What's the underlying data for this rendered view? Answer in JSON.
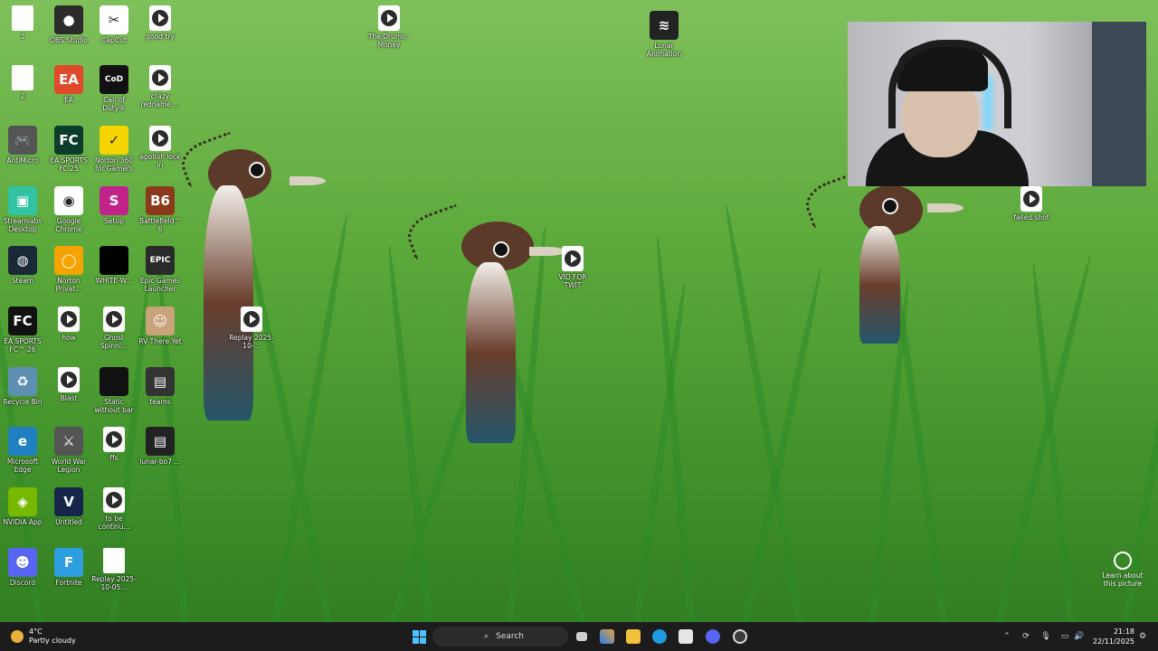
{
  "desktop": {
    "icons": [
      {
        "label": "1",
        "type": "doc"
      },
      {
        "label": "OBS Studio",
        "type": "app",
        "color": "#2b2b2b",
        "glyph": "●"
      },
      {
        "label": "CapCut",
        "type": "app",
        "color": "#ffffff",
        "glyph": "✂"
      },
      {
        "label": "good try",
        "type": "vid"
      },
      {
        "label": "The Drums - Money",
        "type": "vid"
      },
      {
        "label": "Lunar Animation",
        "type": "app",
        "color": "#222222",
        "glyph": "≋"
      },
      {
        "label": "2",
        "type": "doc"
      },
      {
        "label": "EA",
        "type": "app",
        "color": "#e04a2a",
        "glyph": "EA"
      },
      {
        "label": "Call of Duty®",
        "type": "app",
        "color": "#111111",
        "glyph": "CoD"
      },
      {
        "label": "crazy redname ...",
        "type": "vid"
      },
      {
        "label": "AntiMicro",
        "type": "app",
        "color": "#555555",
        "glyph": "🎮"
      },
      {
        "label": "EA SPORTS FC 25",
        "type": "app",
        "color": "#0c3d2a",
        "glyph": "FC"
      },
      {
        "label": "Norton 360 for Gamers",
        "type": "app",
        "color": "#f5d400",
        "glyph": "✓"
      },
      {
        "label": "apolloh lock in",
        "type": "vid"
      },
      {
        "label": "Streamlabs Desktop",
        "type": "app",
        "color": "#31c3a2",
        "glyph": "▣"
      },
      {
        "label": "Google Chrome",
        "type": "app",
        "color": "#ffffff",
        "glyph": "◉"
      },
      {
        "label": "Setup",
        "type": "app",
        "color": "#c1238a",
        "glyph": "S"
      },
      {
        "label": "Battlefield™ 6",
        "type": "app",
        "color": "#8a3a1a",
        "glyph": "B6"
      },
      {
        "label": "Steam",
        "type": "app",
        "color": "#1b2838",
        "glyph": "◍"
      },
      {
        "label": "Norton Privat...",
        "type": "app",
        "color": "#f5a300",
        "glyph": "◯"
      },
      {
        "label": "WHITE-W...",
        "type": "app",
        "color": "#000000",
        "glyph": ""
      },
      {
        "label": "Epic Games Launcher",
        "type": "app",
        "color": "#2a2a2a",
        "glyph": "EPIC"
      },
      {
        "label": "VID FOR TWIT",
        "type": "vid"
      },
      {
        "label": "EA SPORTS FC™ 26",
        "type": "app",
        "color": "#111111",
        "glyph": "FC"
      },
      {
        "label": "how",
        "type": "vid"
      },
      {
        "label": "Ghost Spinni...",
        "type": "vid"
      },
      {
        "label": "RV There Yet",
        "type": "app",
        "color": "#c9a37a",
        "glyph": "☺"
      },
      {
        "label": "Replay 2025-10-...",
        "type": "vid"
      },
      {
        "label": "Recycle Bin",
        "type": "app",
        "color": "#5d8fb0",
        "glyph": "♻"
      },
      {
        "label": "Blast",
        "type": "vid"
      },
      {
        "label": "Static without bar",
        "type": "app",
        "color": "#111111",
        "glyph": ""
      },
      {
        "label": "teams",
        "type": "app",
        "color": "#333333",
        "glyph": "▤"
      },
      {
        "label": "Microsoft Edge",
        "type": "app",
        "color": "#1f7fc1",
        "glyph": "e"
      },
      {
        "label": "World War Legion",
        "type": "app",
        "color": "#555555",
        "glyph": "⚔"
      },
      {
        "label": "ffs",
        "type": "vid"
      },
      {
        "label": "lunar-bo7 ...",
        "type": "app",
        "color": "#222222",
        "glyph": "▤"
      },
      {
        "label": "NVIDIA App",
        "type": "app",
        "color": "#76b900",
        "glyph": "◈"
      },
      {
        "label": "Untitled",
        "type": "app",
        "color": "#16264a",
        "glyph": "V"
      },
      {
        "label": "to be continu...",
        "type": "vid"
      },
      {
        "label": "Discord",
        "type": "app",
        "color": "#5865f2",
        "glyph": "☻"
      },
      {
        "label": "Fortnite",
        "type": "app",
        "color": "#2d9ee0",
        "glyph": "F"
      },
      {
        "label": "Replay 2025-10-05...",
        "type": "doc"
      },
      {
        "label": "failed shot",
        "type": "vid"
      }
    ],
    "learn_label": "Learn about this picture"
  },
  "taskbar": {
    "weather_temp": "4°C",
    "weather_desc": "Partly cloudy",
    "search_placeholder": "Search",
    "clock_time": "21:18",
    "clock_date": "22/11/2025"
  }
}
